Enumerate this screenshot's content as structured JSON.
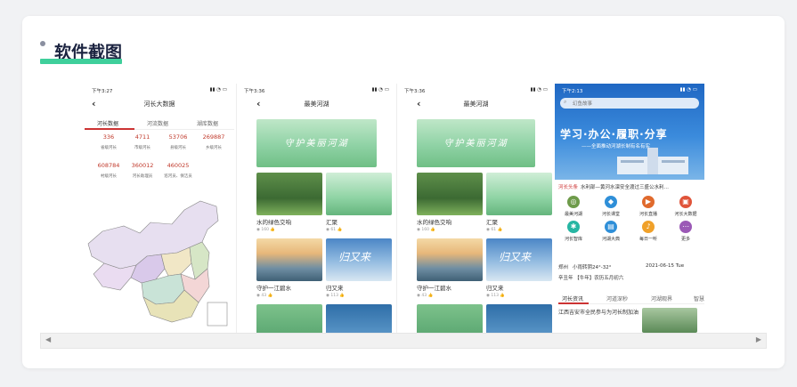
{
  "section": {
    "title": "软件截图"
  },
  "colors": {
    "accent": "#3fcf9b",
    "red": "#c0392b",
    "title": "#1b2340"
  },
  "screen1": {
    "time": "下午3:27",
    "title": "河长大数据",
    "tabs": [
      "河长数据",
      "河流数据",
      "湖库数据"
    ],
    "stats": [
      {
        "value": "336",
        "label": "省级河长"
      },
      {
        "value": "4711",
        "label": "市级河长"
      },
      {
        "value": "53706",
        "label": "县级河长"
      },
      {
        "value": "269887",
        "label": "乡级河长"
      },
      {
        "value": "608784",
        "label": "村级河长"
      },
      {
        "value": "360012",
        "label": "河长助理员"
      },
      {
        "value": "460025",
        "label": "巡河员、保洁员"
      }
    ]
  },
  "screen2": {
    "time": "下午3:36",
    "title": "最美河湖",
    "banner": "守护美丽河湖",
    "tiles": [
      {
        "caption": "水的绿色交响",
        "views": "160"
      },
      {
        "caption": "汇聚",
        "views": "61"
      },
      {
        "caption": "守护一江碧水",
        "views": "43"
      },
      {
        "caption": "归又来",
        "views": "113"
      }
    ],
    "tile_overlay": "归又来"
  },
  "screen3": {
    "time": "下午3:36",
    "title": "最美河湖",
    "banner": "守护美丽河湖",
    "tiles": [
      {
        "caption": "水的绿色交响",
        "views": "160"
      },
      {
        "caption": "汇聚",
        "views": "61"
      },
      {
        "caption": "守护一江碧水",
        "views": "43"
      },
      {
        "caption": "归又来",
        "views": "113"
      }
    ],
    "tile_overlay": "归又来"
  },
  "screen4": {
    "time": "下午2:13",
    "search_placeholder": "幻鱼故事",
    "slogan": "学习·办公·履职·分享",
    "sub": "——全面推动河湖长制有名有实",
    "news_tag": "河长头条",
    "news_title": "水利部—黄河水滦安全渡过三盛公水利…",
    "icons": [
      {
        "label": "最美河湖",
        "color": "#6e9b4a",
        "glyph": "◎"
      },
      {
        "label": "河长课堂",
        "color": "#2f8fd8",
        "glyph": "◆"
      },
      {
        "label": "河长直播",
        "color": "#e06a2d",
        "glyph": "▶"
      },
      {
        "label": "河长大数据",
        "color": "#e0543a",
        "glyph": "▣"
      },
      {
        "label": "河长智库",
        "color": "#27b6a3",
        "glyph": "✱"
      },
      {
        "label": "河湖大典",
        "color": "#2f8fd8",
        "glyph": "▤"
      },
      {
        "label": "每日一听",
        "color": "#f0a12a",
        "glyph": "♪"
      },
      {
        "label": "更多",
        "color": "#9b59b6",
        "glyph": "⋯"
      }
    ],
    "weather_city": "郑州",
    "weather": "小雨转阴24°-32°",
    "date": "2021-06-15  Tue",
    "lunar": "辛丑年 【牛年】农历五月初六",
    "tabs": [
      "河长资讯",
      "河道深秒",
      "河湖观界",
      "智慧"
    ],
    "news_b": "江西吉安市全民参与为河长制加油"
  }
}
